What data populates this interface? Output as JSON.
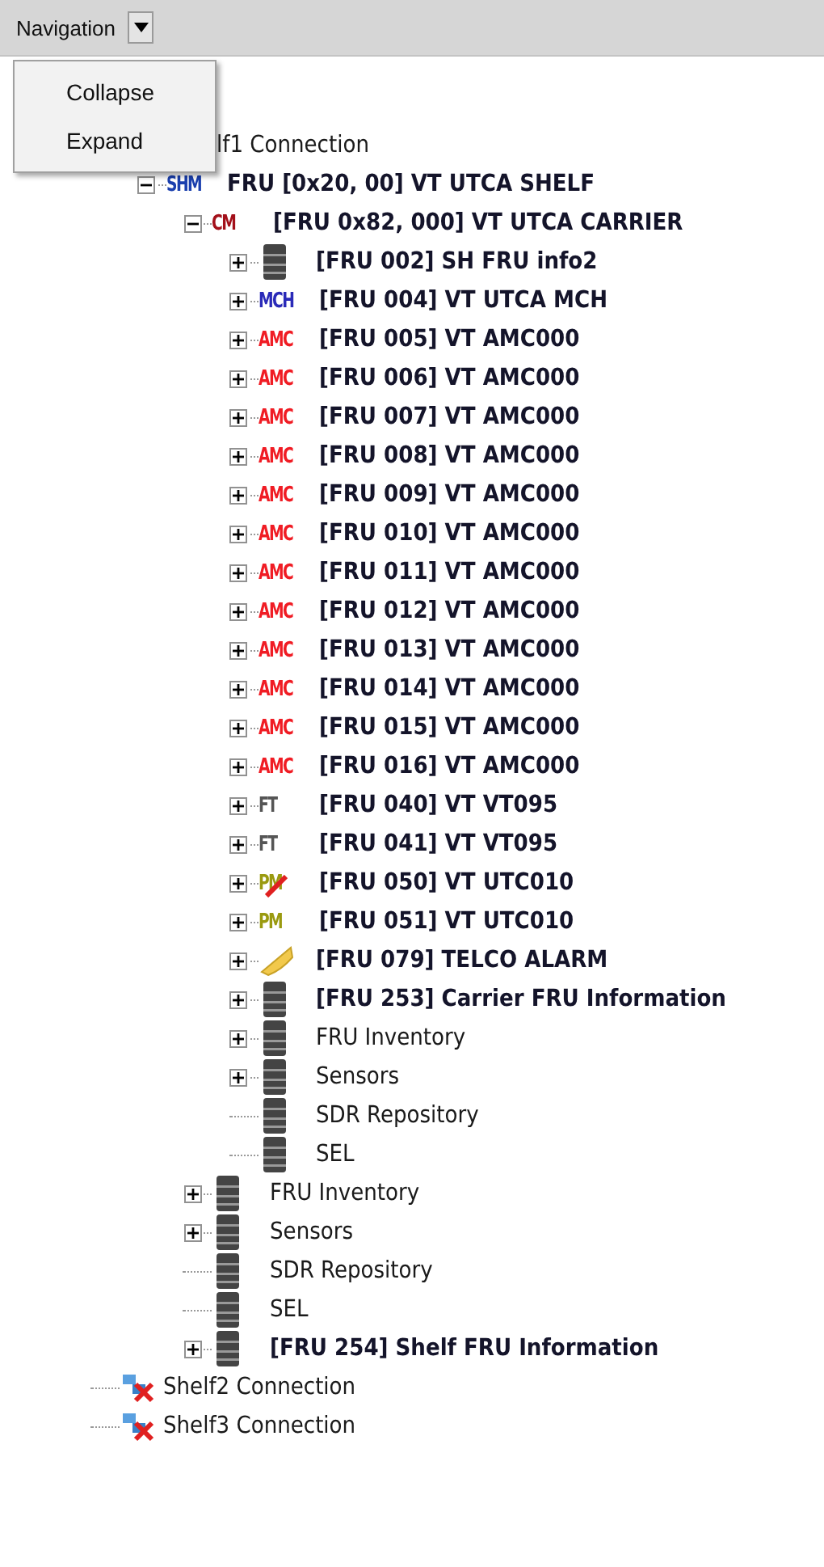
{
  "toolbar": {
    "label": "Navigation"
  },
  "menu": {
    "items": [
      {
        "label": "Collapse"
      },
      {
        "label": "Expand"
      }
    ]
  },
  "tree": [
    {
      "label": "lf1 Connection",
      "bold": false,
      "icon": {
        "kind": "hidden"
      },
      "children": [
        {
          "label": "FRU [0x20, 00] VT UTCA SHELF",
          "bold": true,
          "icon": {
            "kind": "badge",
            "text": "SHM",
            "color": "#1a3fae"
          },
          "expanded": true,
          "children": [
            {
              "label": "[FRU 0x82, 000] VT UTCA CARRIER",
              "bold": true,
              "icon": {
                "kind": "badge",
                "text": "CM",
                "color": "#a3101a"
              },
              "expanded": true,
              "children": [
                {
                  "label": "[FRU 002] SH FRU info2",
                  "bold": true,
                  "icon": {
                    "kind": "db"
                  },
                  "expanded": false
                },
                {
                  "label": "[FRU 004] VT UTCA MCH",
                  "bold": true,
                  "icon": {
                    "kind": "badge",
                    "text": "MCH",
                    "color": "#2a2ab8"
                  },
                  "expanded": false
                },
                {
                  "label": "[FRU 005] VT AMC000",
                  "bold": true,
                  "icon": {
                    "kind": "badge",
                    "text": "AMC",
                    "color": "#f01c24"
                  },
                  "expanded": false
                },
                {
                  "label": "[FRU 006] VT AMC000",
                  "bold": true,
                  "icon": {
                    "kind": "badge",
                    "text": "AMC",
                    "color": "#f01c24"
                  },
                  "expanded": false
                },
                {
                  "label": "[FRU 007] VT AMC000",
                  "bold": true,
                  "icon": {
                    "kind": "badge",
                    "text": "AMC",
                    "color": "#f01c24"
                  },
                  "expanded": false
                },
                {
                  "label": "[FRU 008] VT AMC000",
                  "bold": true,
                  "icon": {
                    "kind": "badge",
                    "text": "AMC",
                    "color": "#f01c24"
                  },
                  "expanded": false
                },
                {
                  "label": "[FRU 009] VT AMC000",
                  "bold": true,
                  "icon": {
                    "kind": "badge",
                    "text": "AMC",
                    "color": "#f01c24"
                  },
                  "expanded": false
                },
                {
                  "label": "[FRU 010] VT AMC000",
                  "bold": true,
                  "icon": {
                    "kind": "badge",
                    "text": "AMC",
                    "color": "#f01c24"
                  },
                  "expanded": false
                },
                {
                  "label": "[FRU 011] VT AMC000",
                  "bold": true,
                  "icon": {
                    "kind": "badge",
                    "text": "AMC",
                    "color": "#f01c24"
                  },
                  "expanded": false
                },
                {
                  "label": "[FRU 012] VT AMC000",
                  "bold": true,
                  "icon": {
                    "kind": "badge",
                    "text": "AMC",
                    "color": "#f01c24"
                  },
                  "expanded": false
                },
                {
                  "label": "[FRU 013] VT AMC000",
                  "bold": true,
                  "icon": {
                    "kind": "badge",
                    "text": "AMC",
                    "color": "#f01c24"
                  },
                  "expanded": false
                },
                {
                  "label": "[FRU 014] VT AMC000",
                  "bold": true,
                  "icon": {
                    "kind": "badge",
                    "text": "AMC",
                    "color": "#f01c24"
                  },
                  "expanded": false
                },
                {
                  "label": "[FRU 015] VT AMC000",
                  "bold": true,
                  "icon": {
                    "kind": "badge",
                    "text": "AMC",
                    "color": "#f01c24"
                  },
                  "expanded": false
                },
                {
                  "label": "[FRU 016] VT AMC000",
                  "bold": true,
                  "icon": {
                    "kind": "badge",
                    "text": "AMC",
                    "color": "#f01c24"
                  },
                  "expanded": false
                },
                {
                  "label": "[FRU 040] VT VT095",
                  "bold": true,
                  "icon": {
                    "kind": "badge",
                    "text": "FT",
                    "color": "#555555"
                  },
                  "expanded": false
                },
                {
                  "label": "[FRU 041] VT VT095",
                  "bold": true,
                  "icon": {
                    "kind": "badge",
                    "text": "FT",
                    "color": "#555555"
                  },
                  "expanded": false
                },
                {
                  "label": "[FRU 050] VT UTC010",
                  "bold": true,
                  "icon": {
                    "kind": "badge-failed",
                    "text": "PM",
                    "color": "#9a9a10"
                  },
                  "expanded": false
                },
                {
                  "label": "[FRU 051] VT UTC010",
                  "bold": true,
                  "icon": {
                    "kind": "badge",
                    "text": "PM",
                    "color": "#9a9a10"
                  },
                  "expanded": false
                },
                {
                  "label": "[FRU 079] TELCO ALARM",
                  "bold": true,
                  "icon": {
                    "kind": "horn"
                  },
                  "expanded": false
                },
                {
                  "label": "[FRU 253] Carrier FRU Information",
                  "bold": true,
                  "icon": {
                    "kind": "db"
                  },
                  "expanded": false
                },
                {
                  "label": "FRU Inventory",
                  "bold": false,
                  "icon": {
                    "kind": "db"
                  },
                  "expanded": false
                },
                {
                  "label": "Sensors",
                  "bold": false,
                  "icon": {
                    "kind": "db"
                  },
                  "expanded": false
                },
                {
                  "label": "SDR Repository",
                  "bold": false,
                  "icon": {
                    "kind": "db"
                  }
                },
                {
                  "label": "SEL",
                  "bold": false,
                  "icon": {
                    "kind": "db"
                  }
                }
              ]
            },
            {
              "label": "FRU Inventory",
              "bold": false,
              "icon": {
                "kind": "db"
              },
              "expanded": false
            },
            {
              "label": "Sensors",
              "bold": false,
              "icon": {
                "kind": "db"
              },
              "expanded": false
            },
            {
              "label": "SDR Repository",
              "bold": false,
              "icon": {
                "kind": "db"
              }
            },
            {
              "label": "SEL",
              "bold": false,
              "icon": {
                "kind": "db"
              }
            },
            {
              "label": "[FRU 254] Shelf FRU Information",
              "bold": true,
              "icon": {
                "kind": "db"
              },
              "expanded": false
            }
          ]
        }
      ]
    },
    {
      "label": "Shelf2 Connection",
      "bold": false,
      "icon": {
        "kind": "disconnected"
      }
    },
    {
      "label": "Shelf3 Connection",
      "bold": false,
      "icon": {
        "kind": "disconnected"
      }
    }
  ]
}
